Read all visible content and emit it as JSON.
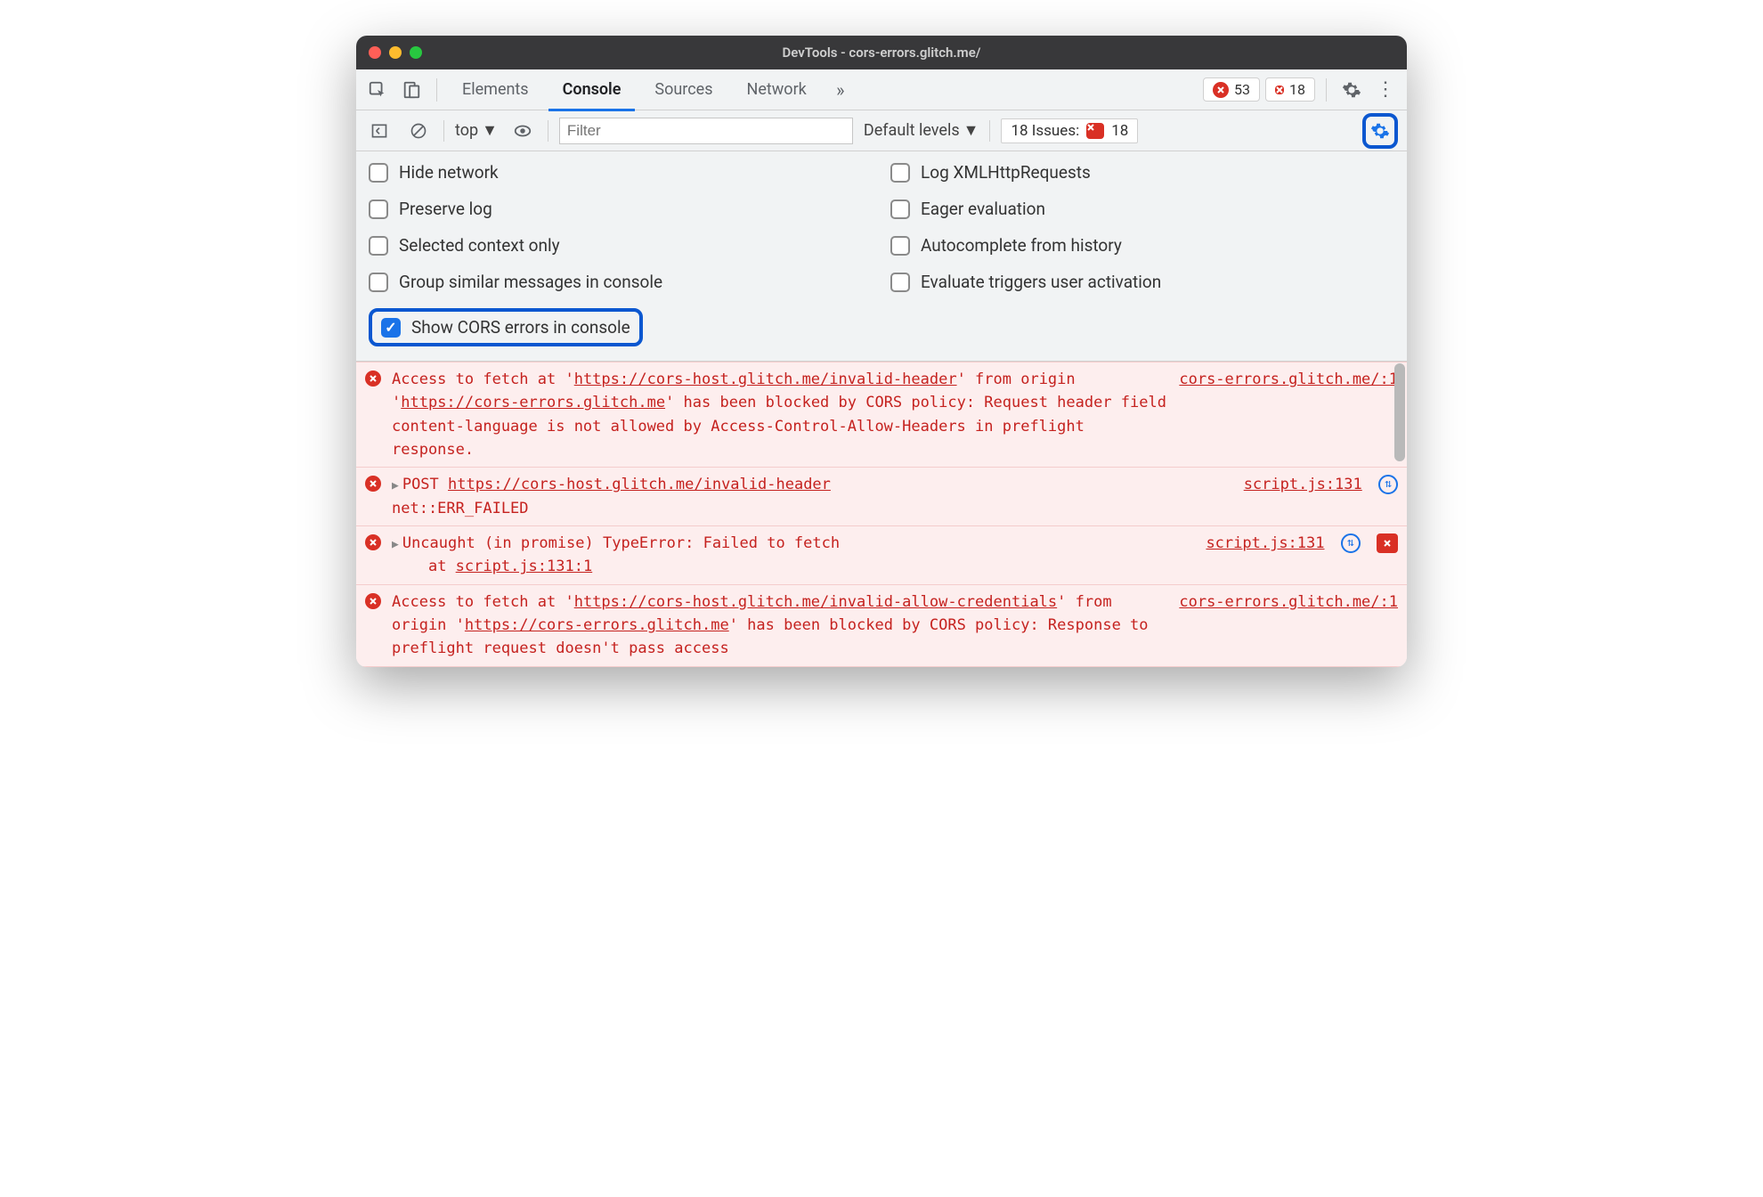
{
  "window": {
    "title": "DevTools - cors-errors.glitch.me/"
  },
  "tabs": {
    "elements": "Elements",
    "console": "Console",
    "sources": "Sources",
    "network": "Network"
  },
  "counters": {
    "errors": "53",
    "issues": "18"
  },
  "subbar": {
    "context": "top",
    "filter_placeholder": "Filter",
    "levels": "Default levels",
    "issues_label": "18 Issues:",
    "issues_count": "18"
  },
  "settings": {
    "hide_network": "Hide network",
    "log_xhr": "Log XMLHttpRequests",
    "preserve_log": "Preserve log",
    "eager_eval": "Eager evaluation",
    "selected_ctx": "Selected context only",
    "autocomplete": "Autocomplete from history",
    "group_similar": "Group similar messages in console",
    "eval_triggers": "Evaluate triggers user activation",
    "show_cors": "Show CORS errors in console"
  },
  "logs": {
    "r1": {
      "pre": "Access to fetch at '",
      "url1": "https://cors-host.glitch.me/invalid-header",
      "mid1": "' from origin '",
      "url2": "https://cors-errors.glitch.me",
      "post": "' has been blocked by CORS policy: Request header field content-language is not allowed by Access-Control-Allow-Headers in preflight response.",
      "src": "cors-errors.glitch.me/:1"
    },
    "r2": {
      "method": "POST",
      "url": "https://cors-host.glitch.me/invalid-header",
      "net": "net::ERR_FAILED",
      "src": "script.js:131"
    },
    "r3": {
      "msg": "Uncaught (in promise) TypeError: Failed to fetch",
      "at": "at ",
      "loc": "script.js:131:1",
      "src": "script.js:131"
    },
    "r4": {
      "pre": "Access to fetch at '",
      "url1": "https://cors-host.glitch.me/invalid-allow-credentials",
      "mid1": "' from origin '",
      "url2": "https://cors-errors.glitch.me",
      "post": "' has been blocked by CORS policy: Response to preflight request doesn't pass access",
      "src": "cors-errors.glitch.me/:1"
    }
  }
}
